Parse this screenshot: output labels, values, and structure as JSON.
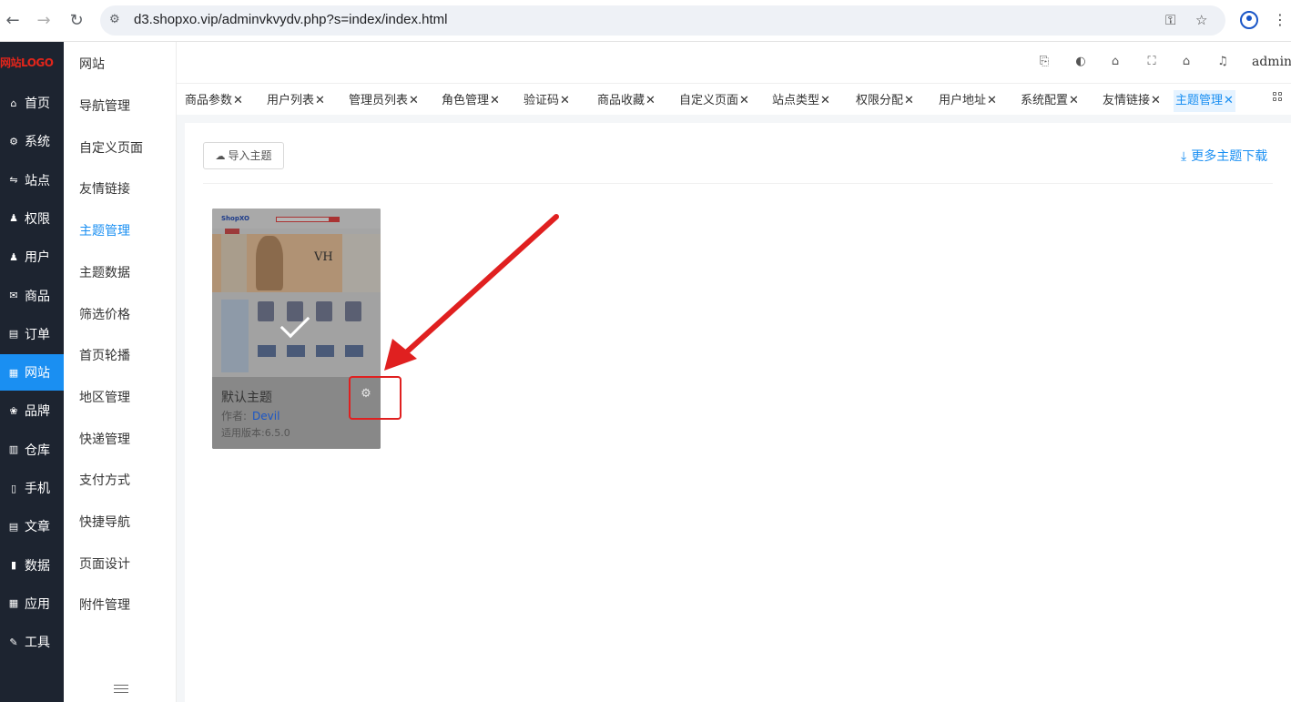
{
  "browser": {
    "url": "d3.shopxo.vip/adminvkvydv.php?s=index/index.html"
  },
  "sidebar": {
    "logo": "网站LOGO",
    "items": [
      {
        "label": "首页",
        "icon": "home-icon"
      },
      {
        "label": "系统",
        "icon": "gear-icon"
      },
      {
        "label": "站点",
        "icon": "sliders-icon"
      },
      {
        "label": "权限",
        "icon": "user-key-icon"
      },
      {
        "label": "用户",
        "icon": "user-icon"
      },
      {
        "label": "商品",
        "icon": "mail-icon"
      },
      {
        "label": "订单",
        "icon": "order-icon"
      },
      {
        "label": "网站",
        "icon": "website-icon"
      },
      {
        "label": "品牌",
        "icon": "brand-icon"
      },
      {
        "label": "仓库",
        "icon": "warehouse-icon"
      },
      {
        "label": "手机",
        "icon": "phone-icon"
      },
      {
        "label": "文章",
        "icon": "article-icon"
      },
      {
        "label": "数据",
        "icon": "chart-icon"
      },
      {
        "label": "应用",
        "icon": "apps-icon"
      },
      {
        "label": "工具",
        "icon": "wrench-icon"
      }
    ],
    "active": "网站"
  },
  "submenu": {
    "title": "网站",
    "items": [
      "导航管理",
      "自定义页面",
      "友情链接",
      "主题管理",
      "主题数据",
      "筛选价格",
      "首页轮播",
      "地区管理",
      "快递管理",
      "支付方式",
      "快捷导航",
      "页面设计",
      "附件管理"
    ],
    "active": "主题管理"
  },
  "header": {
    "user": "admin"
  },
  "tabs": [
    "商品参数",
    "用户列表",
    "管理员列表",
    "角色管理",
    "验证码",
    "商品收藏",
    "自定义页面",
    "站点类型",
    "权限分配",
    "用户地址",
    "系统配置",
    "友情链接",
    "主题管理"
  ],
  "tab_close": "✕",
  "active_tab": "主题管理",
  "main": {
    "import_button": "导入主题",
    "download_link": "更多主题下载"
  },
  "theme": {
    "name": "默认主题",
    "author_label": "作者:",
    "author": "Devil",
    "version_label": "适用版本:",
    "version": "6.5.0",
    "thumb_logo": "ShopXO",
    "thumb_brand": "VH"
  },
  "colors": {
    "accent": "#1a8ff2",
    "sidebar_bg": "#1d2430",
    "annotation": "#e02020"
  }
}
